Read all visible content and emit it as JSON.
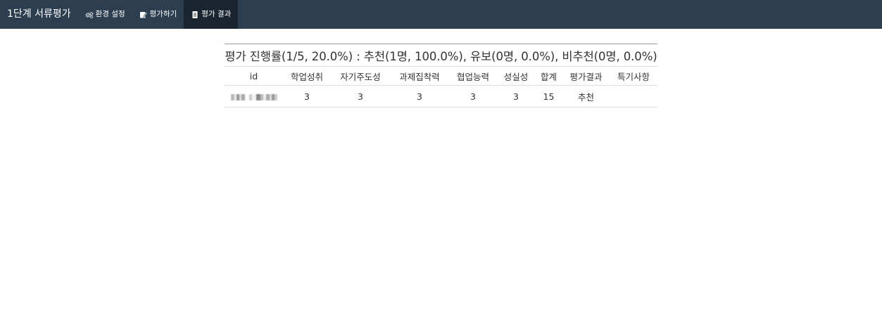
{
  "navbar": {
    "brand": "1단계 서류평가",
    "items": [
      {
        "label": "환경 설정",
        "icon": "gears-icon",
        "active": false
      },
      {
        "label": "평가하기",
        "icon": "edit-icon",
        "active": false
      },
      {
        "label": "평가 결과",
        "icon": "document-icon",
        "active": true
      }
    ],
    "colors": {
      "background": "#2c3e50",
      "active_background": "#1a252f",
      "text": "#ffffff"
    }
  },
  "results": {
    "caption": "평가 진행률(1/5, 20.0%) : 추천(1명, 100.0%), 유보(0명, 0.0%), 비추천(0명, 0.0%)",
    "headers": [
      "id",
      "학업성취",
      "자기주도성",
      "과제집착력",
      "협업능력",
      "성실성",
      "합계",
      "평가결과",
      "특기사항"
    ],
    "rows": [
      {
        "id": "",
        "scores": [
          "3",
          "3",
          "3",
          "3",
          "3"
        ],
        "total": "15",
        "result": "추천",
        "note": ""
      }
    ]
  }
}
